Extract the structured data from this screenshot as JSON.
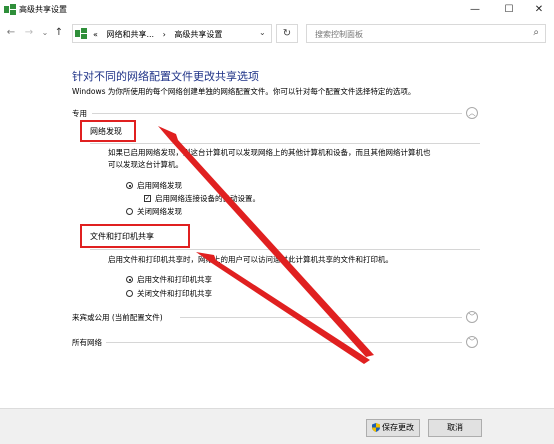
{
  "window": {
    "title": "高级共享设置",
    "controls": {
      "minimize": "—",
      "maximize": "☐",
      "close": "✕"
    }
  },
  "nav": {
    "back": "←",
    "forward": "→",
    "recent": "⌄",
    "up": "↑",
    "breadcrumb": [
      "«",
      "网络和共享...",
      "›",
      "高级共享设置"
    ],
    "dropdown": "⌄",
    "refresh": "↻",
    "search_placeholder": "搜索控制面板",
    "search_icon": "⌕"
  },
  "main": {
    "heading": "针对不同的网络配置文件更改共享选项",
    "subtext": "Windows 为你所使用的每个网络创建单独的网络配置文件。你可以针对每个配置文件选择特定的选项。",
    "profile_private": {
      "label": "专用",
      "chevron": "︿",
      "network_discovery": {
        "title": "网络发现",
        "desc_line1": "如果已启用网络发现，则这台计算机可以发现网络上的其他计算机和设备，而且其他网络计算机也",
        "desc_line2": "可以发现这台计算机。",
        "option_on": "启用网络发现",
        "auto_setup": "启用网络连接设备的自动设置。",
        "option_off": "关闭网络发现"
      },
      "file_printer_sharing": {
        "title": "文件和打印机共享",
        "desc": "启用文件和打印机共享时，网络上的用户可以访问通过此计算机共享的文件和打印机。",
        "option_on": "启用文件和打印机共享",
        "option_off": "关闭文件和打印机共享"
      }
    },
    "profile_guest": {
      "label": "来宾或公用 (当前配置文件)",
      "chevron": "﹀"
    },
    "profile_all": {
      "label": "所有网络",
      "chevron": "﹀"
    }
  },
  "footer": {
    "save_label": "保存更改",
    "cancel_label": "取消"
  },
  "colors": {
    "heading": "#1e3287",
    "annotation": "#e02020"
  }
}
